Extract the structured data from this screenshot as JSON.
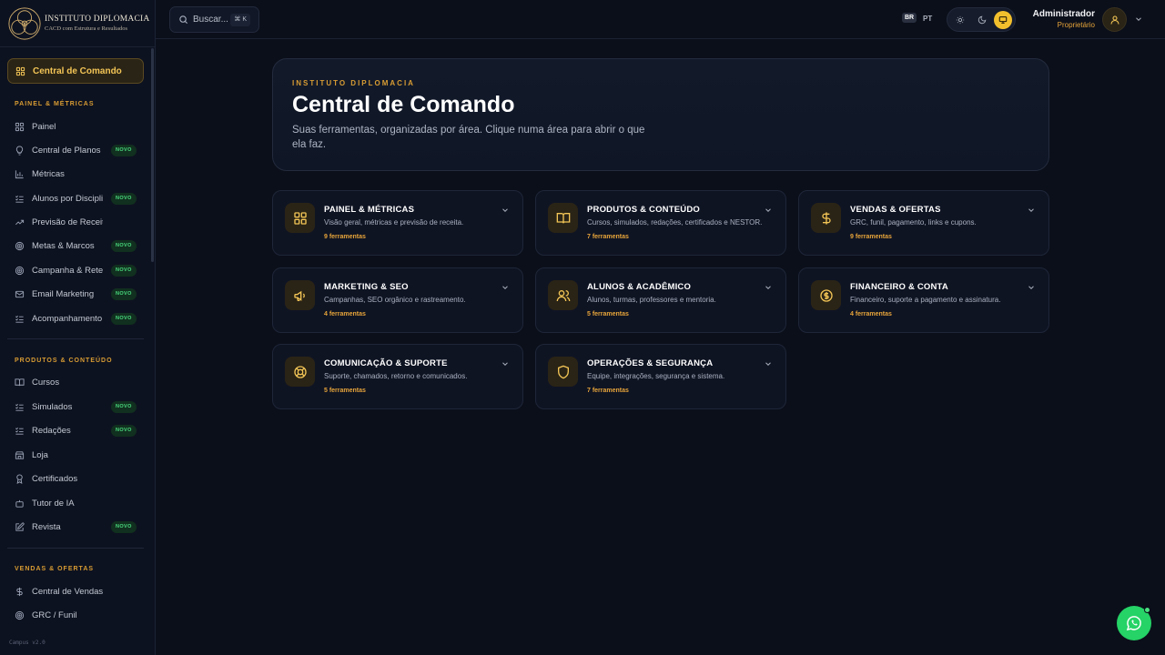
{
  "brand": {
    "name": "INSTITUTO DIPLOMACIA",
    "tagline": "CACD com Estrutura e Resultados"
  },
  "sidebar": {
    "active": {
      "label": "Central de Comando",
      "icon": "grid-icon"
    },
    "sections": [
      {
        "title": "PAINEL & MÉTRICAS",
        "items": [
          {
            "label": "Painel",
            "icon": "grid-icon",
            "badge": ""
          },
          {
            "label": "Central de Planos",
            "icon": "lightbulb-icon",
            "badge": "NOVO"
          },
          {
            "label": "Métricas",
            "icon": "bar-chart-icon",
            "badge": ""
          },
          {
            "label": "Alunos por Disciplina",
            "icon": "list-check-icon",
            "badge": "NOVO"
          },
          {
            "label": "Previsão de Receita",
            "icon": "trending-up-icon",
            "badge": ""
          },
          {
            "label": "Metas & Marcos",
            "icon": "target-icon",
            "badge": "NOVO"
          },
          {
            "label": "Campanha & Retenção",
            "icon": "target-icon",
            "badge": "NOVO"
          },
          {
            "label": "Email Marketing",
            "icon": "mail-icon",
            "badge": "NOVO"
          },
          {
            "label": "Acompanhamento",
            "icon": "list-check-icon",
            "badge": "NOVO"
          }
        ]
      },
      {
        "title": "PRODUTOS & CONTEÚDO",
        "items": [
          {
            "label": "Cursos",
            "icon": "book-icon",
            "badge": ""
          },
          {
            "label": "Simulados",
            "icon": "list-check-icon",
            "badge": "NOVO"
          },
          {
            "label": "Redações",
            "icon": "list-check-icon",
            "badge": "NOVO"
          },
          {
            "label": "Loja",
            "icon": "store-icon",
            "badge": ""
          },
          {
            "label": "Certificados",
            "icon": "award-icon",
            "badge": ""
          },
          {
            "label": "Tutor de IA",
            "icon": "bot-icon",
            "badge": ""
          },
          {
            "label": "Revista",
            "icon": "edit-icon",
            "badge": "NOVO"
          }
        ]
      },
      {
        "title": "VENDAS & OFERTAS",
        "items": [
          {
            "label": "Central de Vendas",
            "icon": "dollar-icon",
            "badge": ""
          },
          {
            "label": "GRC / Funil",
            "icon": "target-icon",
            "badge": ""
          }
        ]
      }
    ],
    "version": "Campus v2.0"
  },
  "topbar": {
    "search_label": "Buscar...",
    "search_shortcut": "⌘ K",
    "lang_flag": "BR",
    "lang_code": "PT",
    "user_name": "Administrador",
    "user_role": "Proprietário"
  },
  "hero": {
    "eyebrow": "INSTITUTO DIPLOMACIA",
    "title": "Central de Comando",
    "subtitle": "Suas ferramentas, organizadas por área. Clique numa área para abrir o que ela faz."
  },
  "cards": [
    {
      "title": "PAINEL & MÉTRICAS",
      "desc": "Visão geral, métricas e previsão de receita.",
      "count": "9 ferramentas",
      "icon": "grid-icon"
    },
    {
      "title": "PRODUTOS & CONTEÚDO",
      "desc": "Cursos, simulados, redações, certificados e NESTOR.",
      "count": "7 ferramentas",
      "icon": "book-icon"
    },
    {
      "title": "VENDAS & OFERTAS",
      "desc": "GRC, funil, pagamento, links e cupons.",
      "count": "9 ferramentas",
      "icon": "dollar-icon"
    },
    {
      "title": "MARKETING & SEO",
      "desc": "Campanhas, SEO orgânico e rastreamento.",
      "count": "4 ferramentas",
      "icon": "megaphone-icon"
    },
    {
      "title": "ALUNOS & ACADÊMICO",
      "desc": "Alunos, turmas, professores e mentoria.",
      "count": "5 ferramentas",
      "icon": "users-icon"
    },
    {
      "title": "FINANCEIRO & CONTA",
      "desc": "Financeiro, suporte a pagamento e assinatura.",
      "count": "4 ferramentas",
      "icon": "coin-icon"
    },
    {
      "title": "COMUNICAÇÃO & SUPORTE",
      "desc": "Suporte, chamados, retorno e comunicados.",
      "count": "5 ferramentas",
      "icon": "lifebuoy-icon"
    },
    {
      "title": "OPERAÇÕES & SEGURANÇA",
      "desc": "Equipe, integrações, segurança e sistema.",
      "count": "7 ferramentas",
      "icon": "shield-icon"
    }
  ],
  "colors": {
    "accent": "#f3c556",
    "accent_dark": "#d89c33",
    "badge_green": "#4ade80",
    "whatsapp": "#25d366",
    "bg": "#0b0f1a"
  }
}
